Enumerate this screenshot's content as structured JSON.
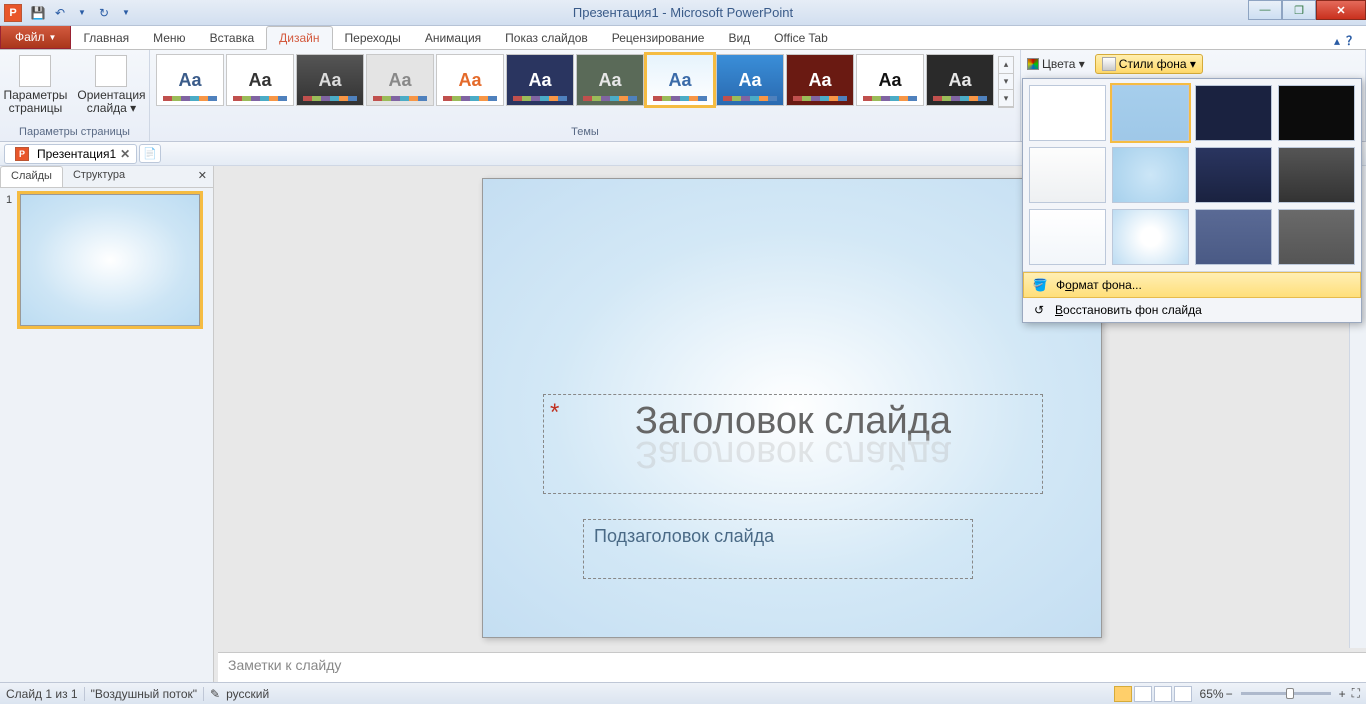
{
  "titlebar": {
    "title": "Презентация1 - Microsoft PowerPoint",
    "qat": {
      "save": "💾",
      "undo": "↶",
      "redo": "↻"
    },
    "window": {
      "min": "—",
      "max": "❐",
      "close": "✕"
    }
  },
  "ribbon": {
    "file": "Файл",
    "tabs": [
      "Главная",
      "Меню",
      "Вставка",
      "Дизайн",
      "Переходы",
      "Анимация",
      "Показ слайдов",
      "Рецензирование",
      "Вид",
      "Office Tab"
    ],
    "active_tab_index": 3,
    "help": "？",
    "expand": "▴"
  },
  "page_setup": {
    "btn1_l1": "Параметры",
    "btn1_l2": "страницы",
    "btn2_l1": "Ориентация",
    "btn2_l2": "слайда ▾",
    "group_label": "Параметры страницы"
  },
  "themes": {
    "label": "Темы",
    "items": [
      {
        "aa": "Aa",
        "bg": "#ffffff",
        "fg": "#3a5b89"
      },
      {
        "aa": "Aa",
        "bg": "#ffffff",
        "fg": "#333"
      },
      {
        "aa": "Aa",
        "bg": "linear-gradient(#555,#333)",
        "fg": "#ddd"
      },
      {
        "aa": "Aa",
        "bg": "#e4e4e4",
        "fg": "#888",
        "style": "outline"
      },
      {
        "aa": "Aa",
        "bg": "#ffffff",
        "fg": "#e46a2a"
      },
      {
        "aa": "Aa",
        "bg": "#2a3560",
        "fg": "#fff"
      },
      {
        "aa": "Aa",
        "bg": "#5a6a58",
        "fg": "#e8e8e8"
      },
      {
        "aa": "Aa",
        "bg": "linear-gradient(#e6f3fc,#fff)",
        "fg": "#3a6aa8",
        "selected": true
      },
      {
        "aa": "Aa",
        "bg": "linear-gradient(#3a8ed8,#2a6ab0)",
        "fg": "#fff"
      },
      {
        "aa": "Aa",
        "bg": "#6a1a12",
        "fg": "#fff",
        "accent": "#e52"
      },
      {
        "aa": "Aa",
        "bg": "#ffffff",
        "fg": "#111",
        "bold": true
      },
      {
        "aa": "Aa",
        "bg": "#2a2a2a",
        "fg": "#e8e8e8"
      }
    ],
    "more_up": "▴",
    "more_dn": "▾",
    "more_exp": "▾"
  },
  "background": {
    "colors_label": "Цвета ▾",
    "styles_btn": "Стили фона ▾",
    "popup": {
      "thumbs": [
        {
          "bg": "#ffffff"
        },
        {
          "bg": "linear-gradient(#a6ceec,#9fc8e8)",
          "selected": true
        },
        {
          "bg": "#1a2240"
        },
        {
          "bg": "#0c0c0c"
        },
        {
          "bg": "linear-gradient(#fdfdfd,#eef0f2)"
        },
        {
          "bg": "radial-gradient(circle,#cce6f7,#a6d0ec)"
        },
        {
          "bg": "linear-gradient(#2a3560,#1a2240)"
        },
        {
          "bg": "linear-gradient(#555,#333)"
        },
        {
          "bg": "linear-gradient(#fff,#f2f6fa)"
        },
        {
          "bg": "radial-gradient(circle,#fff 20%,#bcdcf2)"
        },
        {
          "bg": "linear-gradient(#5a6a95,#4a5a85)"
        },
        {
          "bg": "linear-gradient(#6a6a6a,#555)"
        }
      ],
      "menu1_pre": "Ф",
      "menu1_u": "о",
      "menu1_post": "рмат фона...",
      "menu2_pre": "",
      "menu2_u": "В",
      "menu2_post": "осстановить фон слайда"
    }
  },
  "doc_tabs": {
    "tab1": "Презентация1",
    "close": "✕"
  },
  "left_pane": {
    "tab_slides": "Слайды",
    "tab_outline": "Структура",
    "close": "✕",
    "slide_num": "1"
  },
  "slide": {
    "title": "Заголовок слайда",
    "subtitle": "Подзаголовок слайда",
    "star": "*"
  },
  "notes": {
    "placeholder": "Заметки к слайду"
  },
  "status": {
    "slide_pos": "Слайд 1 из 1",
    "theme": "\"Воздушный поток\"",
    "lang": "русский",
    "zoom": "65%",
    "plus": "+",
    "minus": "−",
    "fit": "⛶"
  }
}
